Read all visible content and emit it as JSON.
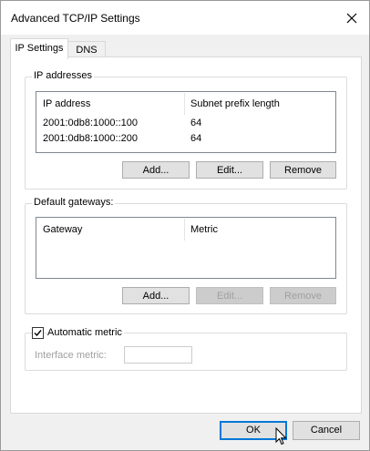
{
  "window": {
    "title": "Advanced TCP/IP Settings",
    "close_icon": "close-icon"
  },
  "tabs": [
    {
      "label": "IP Settings",
      "selected": true
    },
    {
      "label": "DNS",
      "selected": false
    }
  ],
  "ip_addresses": {
    "legend": "IP addresses",
    "columns": [
      "IP address",
      "Subnet prefix length"
    ],
    "rows": [
      [
        "2001:0db8:1000::100",
        "64"
      ],
      [
        "2001:0db8:1000::200",
        "64"
      ]
    ],
    "buttons": {
      "add": "Add...",
      "edit": "Edit...",
      "remove": "Remove"
    }
  },
  "gateways": {
    "legend": "Default gateways:",
    "columns": [
      "Gateway",
      "Metric"
    ],
    "rows": [],
    "buttons": {
      "add": "Add...",
      "edit": "Edit...",
      "remove": "Remove"
    },
    "edit_enabled": false,
    "remove_enabled": false
  },
  "metric": {
    "automatic_label": "Automatic metric",
    "automatic_checked": true,
    "interface_label": "Interface metric:",
    "interface_value": "",
    "interface_enabled": false
  },
  "footer": {
    "ok": "OK",
    "cancel": "Cancel"
  },
  "colors": {
    "accent": "#0078d7",
    "disabled_text": "#a0a0a0"
  }
}
